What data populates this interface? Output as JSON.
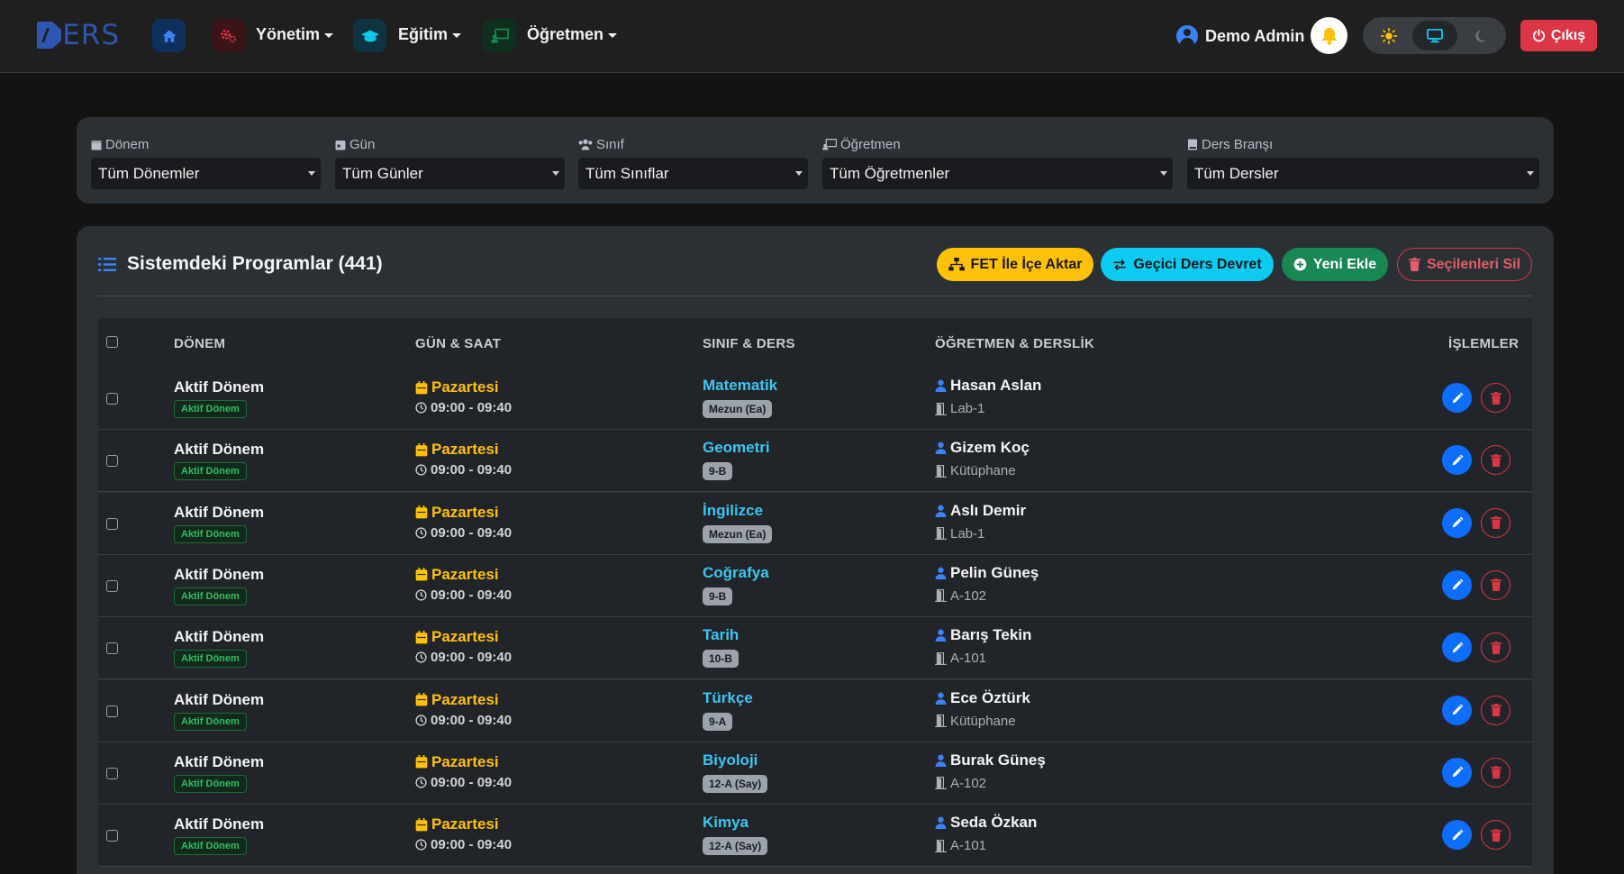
{
  "brand": {
    "text": "ERS",
    "logo_letter": "D"
  },
  "nav": {
    "items": [
      {
        "label": "",
        "icon": "home-icon",
        "color": "#0d6efd"
      },
      {
        "label": "Yönetim",
        "icon": "gears-icon",
        "color": "#dc3545"
      },
      {
        "label": "Eğitim",
        "icon": "graduation-cap-icon",
        "color": "#0dcaf0"
      },
      {
        "label": "Öğretmen",
        "icon": "teacher-board-icon",
        "color": "#198754"
      }
    ]
  },
  "user": {
    "name": "Demo Admin"
  },
  "theme": {
    "options": [
      "light",
      "auto",
      "dark"
    ],
    "active": "auto"
  },
  "logout": {
    "label": "Çıkış"
  },
  "filters": [
    {
      "label": "Dönem",
      "value": "Tüm Dönemler",
      "icon": "calendar-icon"
    },
    {
      "label": "Gün",
      "value": "Tüm Günler",
      "icon": "calendar-day-icon"
    },
    {
      "label": "Sınıf",
      "value": "Tüm Sınıflar",
      "icon": "users-icon"
    },
    {
      "label": "Öğretmen",
      "value": "Tüm Öğretmenler",
      "icon": "chalkboard-icon"
    },
    {
      "label": "Ders Branşı",
      "value": "Tüm Dersler",
      "icon": "book-icon"
    }
  ],
  "main": {
    "title": "Sistemdeki Programlar (441)",
    "actions": {
      "fet": "FET İle İçe Aktar",
      "devret": "Geçici Ders Devret",
      "yeni": "Yeni Ekle",
      "sil": "Seçilenleri Sil"
    },
    "columns": {
      "donem": "DÖNEM",
      "gun_saat": "GÜN & SAAT",
      "sinif_ders": "SINIF & DERS",
      "ogretmen_derslik": "ÖĞRETMEN & DERSLİK",
      "islemler": "İŞLEMLER"
    },
    "rows": [
      {
        "donem": "Aktif Dönem",
        "donem_badge": "Aktif Dönem",
        "gun": "Pazartesi",
        "saat": "09:00 - 09:40",
        "ders": "Matematik",
        "sinif": "Mezun (Ea)",
        "ogretmen": "Hasan Aslan",
        "derslik": "Lab-1"
      },
      {
        "donem": "Aktif Dönem",
        "donem_badge": "Aktif Dönem",
        "gun": "Pazartesi",
        "saat": "09:00 - 09:40",
        "ders": "Geometri",
        "sinif": "9-B",
        "ogretmen": "Gizem Koç",
        "derslik": "Kütüphane"
      },
      {
        "donem": "Aktif Dönem",
        "donem_badge": "Aktif Dönem",
        "gun": "Pazartesi",
        "saat": "09:00 - 09:40",
        "ders": "İngilizce",
        "sinif": "Mezun (Ea)",
        "ogretmen": "Aslı Demir",
        "derslik": "Lab-1"
      },
      {
        "donem": "Aktif Dönem",
        "donem_badge": "Aktif Dönem",
        "gun": "Pazartesi",
        "saat": "09:00 - 09:40",
        "ders": "Coğrafya",
        "sinif": "9-B",
        "ogretmen": "Pelin Güneş",
        "derslik": "A-102"
      },
      {
        "donem": "Aktif Dönem",
        "donem_badge": "Aktif Dönem",
        "gun": "Pazartesi",
        "saat": "09:00 - 09:40",
        "ders": "Tarih",
        "sinif": "10-B",
        "ogretmen": "Barış Tekin",
        "derslik": "A-101"
      },
      {
        "donem": "Aktif Dönem",
        "donem_badge": "Aktif Dönem",
        "gun": "Pazartesi",
        "saat": "09:00 - 09:40",
        "ders": "Türkçe",
        "sinif": "9-A",
        "ogretmen": "Ece Öztürk",
        "derslik": "Kütüphane"
      },
      {
        "donem": "Aktif Dönem",
        "donem_badge": "Aktif Dönem",
        "gun": "Pazartesi",
        "saat": "09:00 - 09:40",
        "ders": "Biyoloji",
        "sinif": "12-A (Say)",
        "ogretmen": "Burak Güneş",
        "derslik": "A-102"
      },
      {
        "donem": "Aktif Dönem",
        "donem_badge": "Aktif Dönem",
        "gun": "Pazartesi",
        "saat": "09:00 - 09:40",
        "ders": "Kimya",
        "sinif": "12-A (Say)",
        "ogretmen": "Seda Özkan",
        "derslik": "A-101"
      }
    ]
  },
  "colors": {
    "accent_blue": "#0d6efd",
    "danger": "#dc3545",
    "warning": "#ffc107",
    "info": "#0dcaf0",
    "success": "#198754",
    "lesson_text": "#3cc6f0"
  }
}
